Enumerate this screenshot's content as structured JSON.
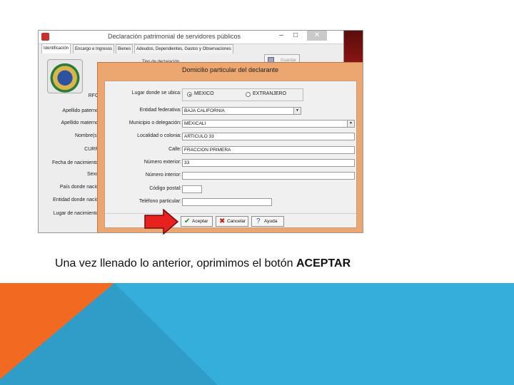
{
  "main_window": {
    "title": "Declaración patrimonial de servidores públicos",
    "controls": {
      "minimize": "–",
      "maximize": "□",
      "close": "✕"
    },
    "tabs": [
      "Identificación",
      "Encargo e Ingresos",
      "Bienes",
      "Adeudos, Dependientes, Gastos y Observaciones"
    ],
    "save_button": "Guardar",
    "tipo_label": "Tipo de declaración",
    "left_labels": [
      "RFC",
      "Apellido paterno",
      "Apellido materno",
      "Nombre(s)",
      "CURP",
      "Fecha de nacimiento",
      "Sexo",
      "País donde nació",
      "Entidad donde nació",
      "Lugar de nacimiento"
    ]
  },
  "dialog": {
    "title": "Domicilio particular del declarante",
    "fields": {
      "ubicacion": {
        "label": "Lugar donde se ubica:",
        "options": [
          "MEXICO",
          "EXTRANJERO"
        ],
        "selected": "MEXICO"
      },
      "entidad": {
        "label": "Entidad federativa:",
        "value": "BAJA CALIFORNIA"
      },
      "municipio": {
        "label": "Municipio o delegación:",
        "value": "MEXICALI"
      },
      "localidad": {
        "label": "Localidad o colonia:",
        "value": "ARTICULO 33"
      },
      "calle": {
        "label": "Calle:",
        "value": "FRACCION PRIMERA"
      },
      "num_ext": {
        "label": "Número exterior:",
        "value": "33"
      },
      "num_int": {
        "label": "Número interior:",
        "value": ""
      },
      "cp": {
        "label": "Código postal:",
        "value": ""
      },
      "telefono": {
        "label": "Teléfono particular:",
        "value": ""
      }
    },
    "buttons": {
      "accept": "Aceptar",
      "cancel": "Cancelar",
      "help": "Ayuda"
    }
  },
  "caption": {
    "text": "Una vez llenado lo anterior, oprimimos el botón ",
    "bold": "ACEPTAR"
  },
  "colors": {
    "dialog_frame": "#eca66f",
    "arrow": "#e8201e",
    "band_orange": "#f26a21",
    "band_teal": "#2f9dc7",
    "band_blue": "#36aedb"
  }
}
